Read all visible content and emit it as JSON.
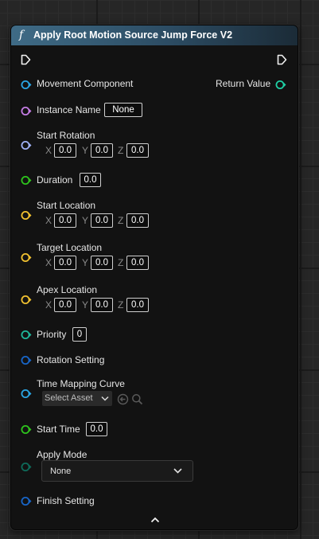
{
  "node": {
    "title": "Apply Root Motion Source Jump Force V2",
    "function_glyph": "f",
    "collapse_icon": "chevron-up-icon"
  },
  "colors": {
    "header_start": "#3f6b86",
    "object_pin": "#2aa6e5",
    "name_pin": "#c67de6",
    "rotator_pin": "#9fb1f5",
    "float_pin": "#2ec51d",
    "vector_pin": "#f2c230",
    "byte_pin": "#1fb89b",
    "struct_pin": "#1866c9",
    "enum_pin": "#0e6b5a",
    "return_pin": "#1fd0a5"
  },
  "pins": {
    "movement_component": "Movement Component",
    "return_value": "Return Value",
    "instance_name": {
      "label": "Instance Name",
      "value": "None"
    },
    "start_rotation": {
      "label": "Start Rotation",
      "x_label": "X",
      "y_label": "Y",
      "z_label": "Z",
      "x": "0.0",
      "y": "0.0",
      "z": "0.0"
    },
    "duration": {
      "label": "Duration",
      "value": "0.0"
    },
    "start_location": {
      "label": "Start Location",
      "x_label": "X",
      "y_label": "Y",
      "z_label": "Z",
      "x": "0.0",
      "y": "0.0",
      "z": "0.0"
    },
    "target_location": {
      "label": "Target Location",
      "x_label": "X",
      "y_label": "Y",
      "z_label": "Z",
      "x": "0.0",
      "y": "0.0",
      "z": "0.0"
    },
    "apex_location": {
      "label": "Apex Location",
      "x_label": "X",
      "y_label": "Y",
      "z_label": "Z",
      "x": "0.0",
      "y": "0.0",
      "z": "0.0"
    },
    "priority": {
      "label": "Priority",
      "value": "0"
    },
    "rotation_setting": "Rotation Setting",
    "time_mapping_curve": {
      "label": "Time Mapping Curve",
      "asset_placeholder": "Select Asset"
    },
    "start_time": {
      "label": "Start Time",
      "value": "0.0"
    },
    "apply_mode": {
      "label": "Apply Mode",
      "value": "None"
    },
    "finish_setting": "Finish Setting"
  }
}
